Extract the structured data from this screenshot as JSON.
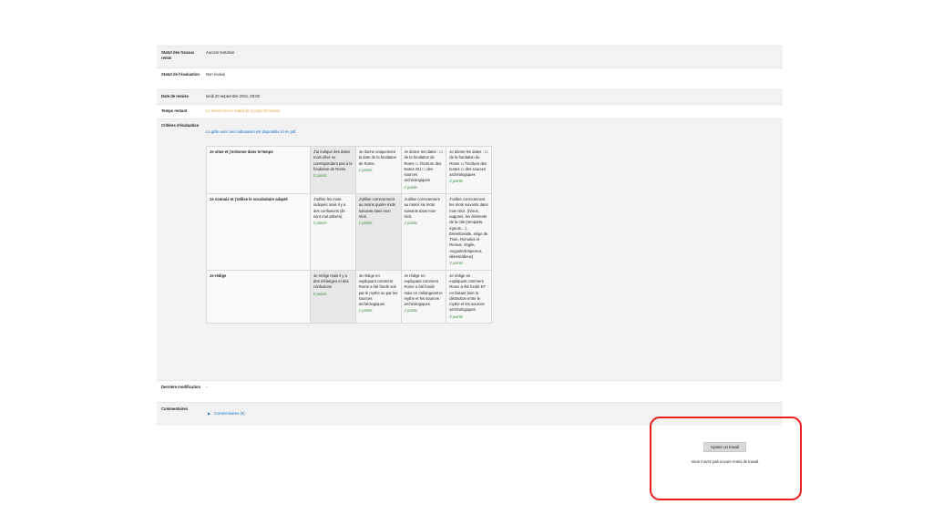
{
  "status": {
    "submission_label": "Statut des travaux remis",
    "submission_value": "Aucune tentative",
    "grading_label": "Statut de l'évaluation",
    "grading_value": "Non évalué",
    "due_label": "Date de remise",
    "due_value": "lundi 20 septembre 2021, 00:00",
    "remaining_label": "Temps restant",
    "remaining_value": "Le devoir est en retard de 4 jours 23 heures",
    "criteria_label": "Critères d'évaluation",
    "rubric_note": "La grille avec ses indicateurs est disponible ici en pdf.",
    "modified_label": "Dernière modification",
    "modified_value": "-",
    "comments_label": "Commentaires",
    "comments_link": "Commentaires (0)"
  },
  "rubric": {
    "criteria": [
      {
        "name": "Je situe et j'ordonne dans le temps",
        "levels": [
          {
            "text": "J'ai indiqué des dates mais elles ne correspondent pas à la fondation de Rome.",
            "points": "0 points"
          },
          {
            "text": "Je donne uniquement la date de la fondation de Rome.",
            "points": "1 points"
          },
          {
            "text": "Je donne les dates : ☐ de la fondation de Rome ☐ l'écriture des textes OU ☐ des sources archéologiques",
            "points": "2 points"
          },
          {
            "text": "Je donne les dates : ☐ de la fondation de Rome ☐ l'écriture des textes ☐ des sources archéologiques",
            "points": "3 points"
          }
        ]
      },
      {
        "name": "Je connais et j'utilise le vocabulaire adapté",
        "levels": [
          {
            "text": "J'utilise les mots indiqués mais il y a des confusions (ils sont mal utilisés).",
            "points": "0 points"
          },
          {
            "text": "J'utilise correctement au moins quatre mots suivants dans mon récit.",
            "points": "1 points"
          },
          {
            "text": "J'utilise correctement au moins six mots suivants dans mon récit.",
            "points": "2 points"
          },
          {
            "text": "J'utilise correctement les mots suivants dans mon récit. (héros, augures, les éléments de la cité (remparts, égouts,...), Enée/Enéide, siège de Troie, Romulus et Remus, Virgile, Auguste/Empereur, déesse/dieux)",
            "points": "3 points"
          }
        ]
      },
      {
        "name": "Je rédige",
        "levels": [
          {
            "text": "Je rédige mais il y a des mélanges et des confusions",
            "points": "0 points"
          },
          {
            "text": "Je rédige en expliquant comment Rome a été fondé soit par le mythe ou par les sources archéologiques.",
            "points": "1 points"
          },
          {
            "text": "Je rédige en expliquant comment Rome a été fondé mais en mélangeant le mythe et les sources archéologiques.",
            "points": "2 points"
          },
          {
            "text": "Je rédige en expliquant comment Rome a été fondé ET en faisant bien la distinction entre le mythe et les sources archéologiques.",
            "points": "3 points"
          }
        ]
      }
    ]
  },
  "submission": {
    "add_button": "Ajouter un travail",
    "no_work": "Vous n'avez pas encore remis de travail."
  },
  "colors": {
    "accent_link": "#1a73c8",
    "late_text": "#e6a23c",
    "points_text": "#3f8e3f",
    "highlight_border": "#e81e1e"
  }
}
